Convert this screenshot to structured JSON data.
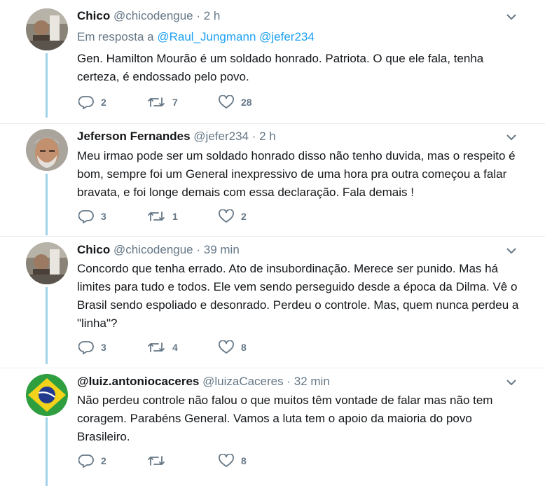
{
  "tweets": [
    {
      "name": "Chico",
      "handle": "@chicodengue",
      "time": "· 2 h",
      "reply_prefix": "Em resposta a",
      "reply_mentions": "@Raul_Jungmann @jefer234",
      "text": "Gen. Hamilton Mourão é um soldado honrado. Patriota. O que ele fala, tenha certeza, é endossado pelo povo.",
      "replies": "2",
      "retweets": "7",
      "likes": "28",
      "avatar_icon": "profile-photo"
    },
    {
      "name": "Jeferson Fernandes",
      "handle": "@jefer234",
      "time": "· 2 h",
      "text": "Meu irmao pode ser um soldado honrado disso não tenho duvida, mas o respeito é bom, sempre foi um General inexpressivo de uma hora pra outra começou a falar bravata, e foi longe demais com essa declaração. Fala demais !",
      "replies": "3",
      "retweets": "1",
      "likes": "2",
      "avatar_icon": "profile-photo"
    },
    {
      "name": "Chico",
      "handle": "@chicodengue",
      "time": "· 39 min",
      "text": "Concordo que tenha errado. Ato de insubordinação. Merece ser punido. Mas há limites para tudo e todos. Ele vem sendo perseguido desde a época da Dilma. Vê o Brasil sendo espoliado e desonrado. Perdeu o controle. Mas, quem nunca perdeu a \"linha\"?",
      "replies": "3",
      "retweets": "4",
      "likes": "8",
      "avatar_icon": "profile-photo"
    },
    {
      "name": "@luiz.antoniocaceres",
      "handle": "@luizaCaceres",
      "time": "· 32 min",
      "text": "Não perdeu controle não falou o que muitos têm vontade de falar mas não tem coragem. Parabéns General. Vamos a luta tem o apoio da maioria do povo Brasileiro.",
      "replies": "2",
      "retweets": "",
      "likes": "8",
      "avatar_icon": "brazil-flag"
    }
  ],
  "colors": {
    "accent": "#1da1f2",
    "secondary_text": "#657786",
    "thread_line": "#9fd3ea"
  },
  "icons": [
    "reply-icon",
    "retweet-icon",
    "like-icon",
    "chevron-down-icon"
  ]
}
